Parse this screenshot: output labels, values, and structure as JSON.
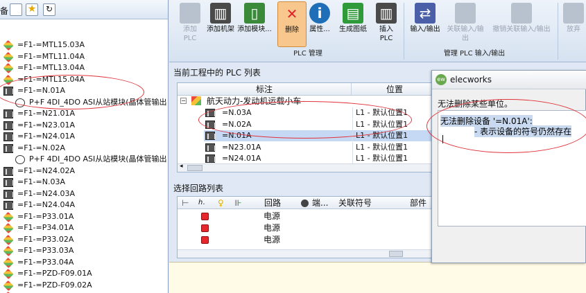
{
  "left_panel": {
    "toolbar_label": "备",
    "tree_items": [
      {
        "text": "=F1-=MTL15.03A",
        "icon": "box",
        "indent": 1
      },
      {
        "text": "=F1-=MTL11.04A",
        "icon": "box",
        "indent": 1
      },
      {
        "text": "=F1-=MTL13.04A",
        "icon": "box",
        "indent": 1
      },
      {
        "text": "=F1-=MTL15.04A",
        "icon": "box",
        "indent": 1
      },
      {
        "text": "=F1-=N.01A",
        "icon": "rack",
        "indent": 1
      },
      {
        "text": "P+F 4DI_4DO ASI从站模块(晶体管输出",
        "icon": "module",
        "indent": 2
      },
      {
        "text": "=F1-=N21.01A",
        "icon": "rack",
        "indent": 1
      },
      {
        "text": "=F1-=N23.01A",
        "icon": "rack",
        "indent": 1
      },
      {
        "text": "=F1-=N24.01A",
        "icon": "rack",
        "indent": 1
      },
      {
        "text": "=F1-=N.02A",
        "icon": "rack",
        "indent": 1
      },
      {
        "text": "P+F 4DI_4DO ASI从站模块(晶体管输出",
        "icon": "module",
        "indent": 2
      },
      {
        "text": "=F1-=N24.02A",
        "icon": "rack",
        "indent": 1
      },
      {
        "text": "=F1-=N.03A",
        "icon": "rack",
        "indent": 1
      },
      {
        "text": "=F1-=N24.03A",
        "icon": "rack",
        "indent": 1
      },
      {
        "text": "=F1-=N24.04A",
        "icon": "rack",
        "indent": 1
      },
      {
        "text": "=F1-=P33.01A",
        "icon": "box",
        "indent": 1
      },
      {
        "text": "=F1-=P34.01A",
        "icon": "box",
        "indent": 1
      },
      {
        "text": "=F1-=P33.02A",
        "icon": "box",
        "indent": 1
      },
      {
        "text": "=F1-=P33.03A",
        "icon": "box",
        "indent": 1
      },
      {
        "text": "=F1-=P33.04A",
        "icon": "box",
        "indent": 1
      },
      {
        "text": "=F1-=PZD-F09.01A",
        "icon": "box",
        "indent": 1
      },
      {
        "text": "=F1-=PZD-F09.02A",
        "icon": "box",
        "indent": 1
      },
      {
        "text": "=F1-=PZD-F09.03A",
        "icon": "box",
        "indent": 1
      }
    ]
  },
  "toolbar": {
    "buttons": [
      {
        "label": "添加\nPLC",
        "icon": "add-plc-icon",
        "enabled": false
      },
      {
        "label": "添加机架",
        "icon": "add-rack-icon",
        "enabled": true
      },
      {
        "label": "添加模块...",
        "icon": "add-module-icon",
        "enabled": true
      },
      {
        "label": "删除",
        "icon": "delete-icon",
        "enabled": true
      },
      {
        "label": "属性...",
        "icon": "properties-icon",
        "enabled": true
      },
      {
        "label": "生成图纸",
        "icon": "generate-drawing-icon",
        "enabled": true
      },
      {
        "label": "插入\nPLC",
        "icon": "insert-plc-icon",
        "enabled": true
      },
      {
        "label": "输入/输出",
        "icon": "io-icon",
        "enabled": true
      },
      {
        "label": "关联输入/输出",
        "icon": "associate-io-icon",
        "enabled": false
      },
      {
        "label": "撤销关联输入/输出",
        "icon": "undo-associate-io-icon",
        "enabled": false
      },
      {
        "label": "放弃",
        "icon": "discard-icon",
        "enabled": false
      }
    ],
    "group_plc": "PLC 管理",
    "group_io": "管理 PLC 输入/输出"
  },
  "plc_list": {
    "title": "当前工程中的 PLC 列表",
    "col_mark": "标注",
    "col_location": "位置",
    "root": "航天动力-发动机运载小车",
    "rows": [
      {
        "mark": "=N.03A",
        "location": "L1 - 默认位置1",
        "selected": false
      },
      {
        "mark": "=N.02A",
        "location": "L1 - 默认位置1",
        "selected": false
      },
      {
        "mark": "=N.01A",
        "location": "L1 - 默认位置1",
        "selected": true
      },
      {
        "mark": "=N23.01A",
        "location": "L1 - 默认位置1",
        "selected": false
      },
      {
        "mark": "=N24.01A",
        "location": "L1 - 默认位置1",
        "selected": false
      }
    ]
  },
  "loop_list": {
    "title": "选择回路列表",
    "col_loop": "回路",
    "col_end": "端...",
    "col_symbol": "关联符号",
    "col_part": "部件",
    "rows": [
      {
        "loop": "电源"
      },
      {
        "loop": "电源"
      },
      {
        "loop": "电源"
      }
    ]
  },
  "dialog": {
    "app_name": "elecworks",
    "logo_text": "ew",
    "message": "无法删除某些单位。",
    "detail_line1": "无法删除设备 '=N.01A':",
    "detail_line2": "- 表示设备的符号仍然存在"
  }
}
